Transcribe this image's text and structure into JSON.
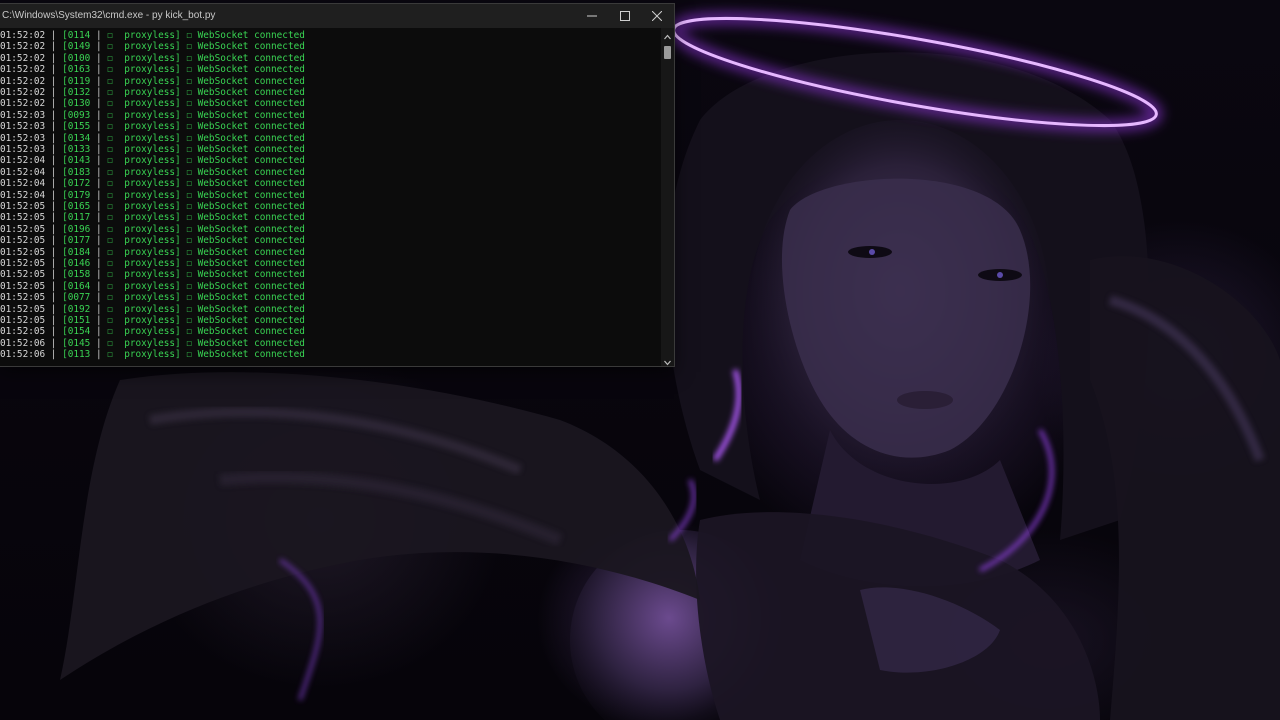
{
  "window": {
    "title": "C:\\Windows\\System32\\cmd.exe - py  kick_bot.py",
    "minimize_icon": "minimize-icon",
    "maximize_icon": "maximize-icon",
    "close_icon": "close-icon"
  },
  "colors": {
    "console_bg": "#0c0c0c",
    "log_green": "#39d353",
    "accent_purple": "#a93cff"
  },
  "log": {
    "mode": "proxyless",
    "status_symbol": "☐",
    "message": "WebSocket connected",
    "entries": [
      {
        "time": "01:52:02",
        "id": "[0114"
      },
      {
        "time": "01:52:02",
        "id": "[0149"
      },
      {
        "time": "01:52:02",
        "id": "[0100"
      },
      {
        "time": "01:52:02",
        "id": "[0163"
      },
      {
        "time": "01:52:02",
        "id": "[0119"
      },
      {
        "time": "01:52:02",
        "id": "[0132"
      },
      {
        "time": "01:52:02",
        "id": "[0130"
      },
      {
        "time": "01:52:03",
        "id": "[0093"
      },
      {
        "time": "01:52:03",
        "id": "[0155"
      },
      {
        "time": "01:52:03",
        "id": "[0134"
      },
      {
        "time": "01:52:03",
        "id": "[0133"
      },
      {
        "time": "01:52:04",
        "id": "[0143"
      },
      {
        "time": "01:52:04",
        "id": "[0183"
      },
      {
        "time": "01:52:04",
        "id": "[0172"
      },
      {
        "time": "01:52:04",
        "id": "[0179"
      },
      {
        "time": "01:52:05",
        "id": "[0165"
      },
      {
        "time": "01:52:05",
        "id": "[0117"
      },
      {
        "time": "01:52:05",
        "id": "[0196"
      },
      {
        "time": "01:52:05",
        "id": "[0177"
      },
      {
        "time": "01:52:05",
        "id": "[0184"
      },
      {
        "time": "01:52:05",
        "id": "[0146"
      },
      {
        "time": "01:52:05",
        "id": "[0158"
      },
      {
        "time": "01:52:05",
        "id": "[0164"
      },
      {
        "time": "01:52:05",
        "id": "[0077"
      },
      {
        "time": "01:52:05",
        "id": "[0192"
      },
      {
        "time": "01:52:05",
        "id": "[0151"
      },
      {
        "time": "01:52:05",
        "id": "[0154"
      },
      {
        "time": "01:52:06",
        "id": "[0145"
      },
      {
        "time": "01:52:06",
        "id": "[0113"
      }
    ]
  },
  "scrollbar": {
    "position_fraction": 0.02,
    "visible_fraction": 0.04,
    "up_icon": "arrow-up-icon",
    "down_icon": "arrow-down-icon"
  }
}
